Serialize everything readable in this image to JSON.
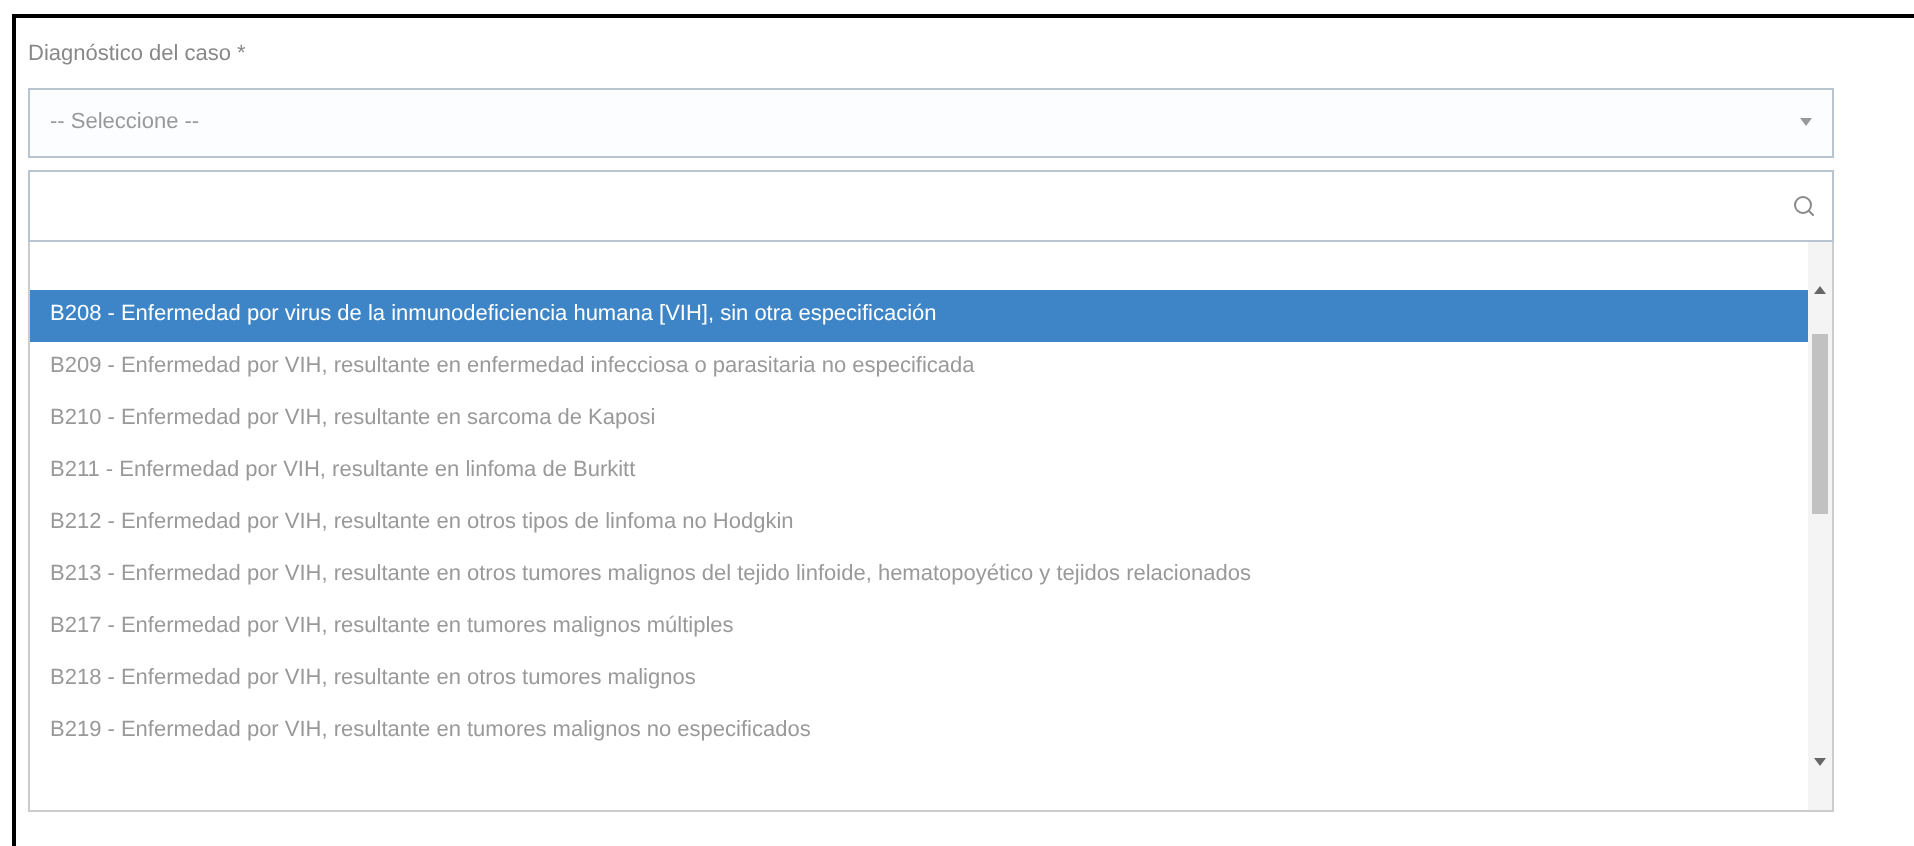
{
  "field": {
    "label": "Diagnóstico del caso *",
    "value": "-- Seleccione --"
  },
  "dropdown": {
    "options": [
      {
        "text": "B208 - Enfermedad por virus de la inmunodeficiencia humana [VIH], sin otra especificación",
        "selected": true
      },
      {
        "text": "B209 - Enfermedad por VIH, resultante en enfermedad infecciosa o parasitaria no especificada",
        "selected": false
      },
      {
        "text": "B210 - Enfermedad por VIH, resultante en sarcoma de Kaposi",
        "selected": false
      },
      {
        "text": "B211 - Enfermedad por VIH, resultante en linfoma de Burkitt",
        "selected": false
      },
      {
        "text": "B212 - Enfermedad por VIH, resultante en otros tipos de linfoma no Hodgkin",
        "selected": false
      },
      {
        "text": "B213 - Enfermedad por VIH, resultante en otros tumores malignos del tejido linfoide, hematopoyético y tejidos relacionados",
        "selected": false
      },
      {
        "text": "B217 - Enfermedad por VIH, resultante en tumores malignos múltiples",
        "selected": false
      },
      {
        "text": "B218 - Enfermedad por VIH, resultante en otros tumores malignos",
        "selected": false
      },
      {
        "text": "B219 - Enfermedad por VIH, resultante en tumores malignos no especificados",
        "selected": false
      }
    ]
  }
}
